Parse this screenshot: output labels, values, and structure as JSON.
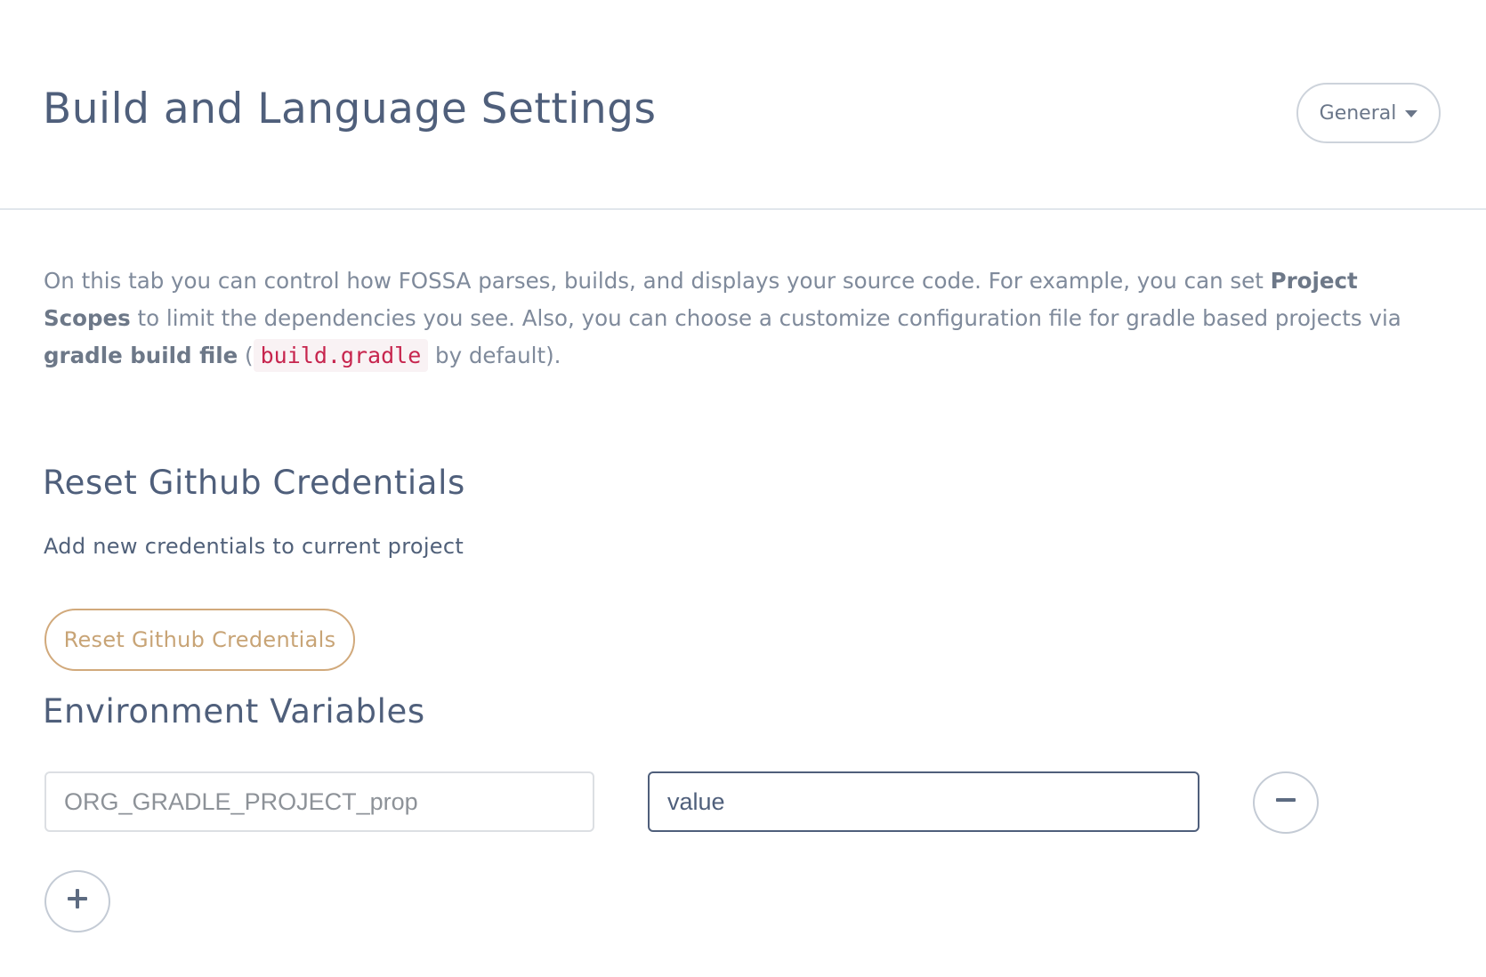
{
  "header": {
    "title": "Build and Language Settings",
    "dropdown": {
      "selected": "General"
    }
  },
  "intro": {
    "part1": "On this tab you can control how FOSSA parses, builds, and displays your source code. For example, you can set ",
    "project_scopes": "Project Scopes",
    "part2": " to limit the dependencies you see. Also, you can choose a customize configuration file for gradle based projects via ",
    "gradle_build_file": "gradle build file",
    "part3": " (",
    "code_default": "build.gradle",
    "part4": " by default)."
  },
  "reset_credentials": {
    "title": "Reset Github Credentials",
    "description": "Add new credentials to current project",
    "button_label": "Reset Github Credentials"
  },
  "environment_variables": {
    "title": "Environment Variables",
    "rows": [
      {
        "key_placeholder": "ORG_GRADLE_PROJECT_prop",
        "key_value": "",
        "value_value": "value"
      }
    ]
  },
  "colors": {
    "heading": "#4f5f7b",
    "muted_text": "#7f8a9b",
    "accent_gold": "#d1a97b",
    "code_text": "#c7254e"
  },
  "icons": {
    "dropdown": "caret-down-icon",
    "remove": "minus-icon",
    "add": "plus-icon"
  }
}
